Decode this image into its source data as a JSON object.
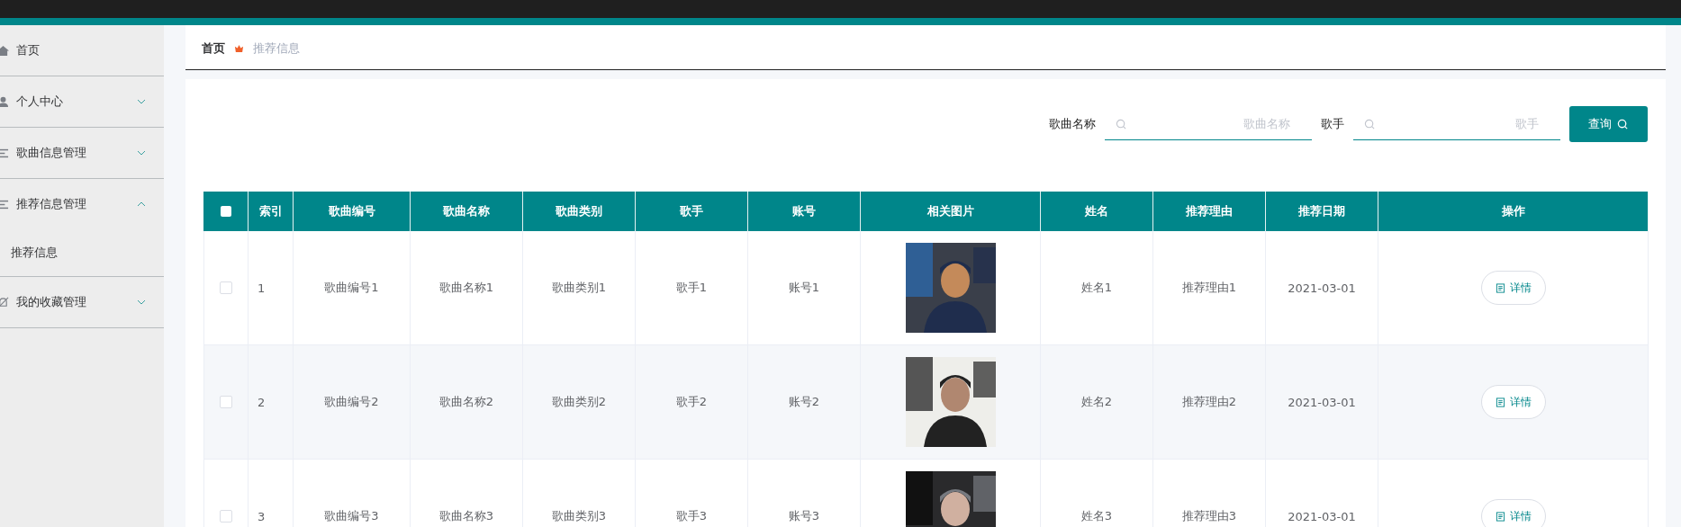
{
  "sidebar": {
    "items": [
      {
        "label": "首页"
      },
      {
        "label": "个人中心",
        "expanded": false
      },
      {
        "label": "歌曲信息管理",
        "expanded": false
      },
      {
        "label": "推荐信息管理",
        "expanded": true,
        "children": [
          {
            "label": "推荐信息",
            "selected": true
          }
        ]
      },
      {
        "label": "我的收藏管理",
        "expanded": false
      }
    ]
  },
  "breadcrumb": [
    {
      "label": "首页",
      "current": false
    },
    {
      "label": "推荐信息",
      "current": true
    }
  ],
  "search": {
    "fields": [
      {
        "label": "歌曲名称",
        "placeholder": "歌曲名称"
      },
      {
        "label": "歌手",
        "placeholder": "歌手"
      }
    ],
    "button": "查询"
  },
  "table": {
    "header_checked": false,
    "columns": [
      "索引",
      "歌曲编号",
      "歌曲名称",
      "歌曲类别",
      "歌手",
      "账号",
      "相关图片",
      "姓名",
      "推荐理由",
      "推荐日期",
      "操作"
    ],
    "rows": [
      {
        "checked": false,
        "cells": [
          "1",
          "歌曲编号1",
          "歌曲名称1",
          "歌曲类别1",
          "歌手1",
          "账号1",
          null,
          "姓名1",
          "推荐理由1",
          "2021-03-01"
        ],
        "picture": {
          "kind": "picture"
        },
        "action": "详情"
      },
      {
        "checked": false,
        "cells": [
          "2",
          "歌曲编号2",
          "歌曲名称2",
          "歌曲类别2",
          "歌手2",
          "账号2",
          null,
          "姓名2",
          "推荐理由2",
          "2021-03-01"
        ],
        "picture": {
          "kind": "picture"
        },
        "action": "详情"
      },
      {
        "checked": false,
        "cells": [
          "3",
          "歌曲编号3",
          "歌曲名称3",
          "歌曲类别3",
          "歌手3",
          "账号3",
          null,
          "姓名3",
          "推荐理由3",
          "2021-03-01"
        ],
        "picture": {
          "kind": "picture"
        },
        "action": "详情"
      }
    ]
  }
}
